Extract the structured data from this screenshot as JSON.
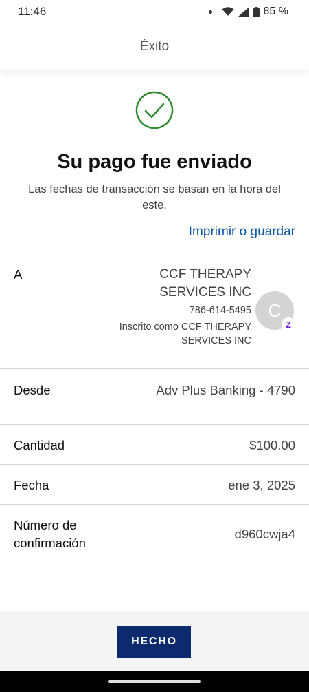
{
  "status_bar": {
    "time": "11:46",
    "battery": "85 %"
  },
  "header": {
    "title": "Éxito"
  },
  "success": {
    "headline": "Su pago fue enviado",
    "subtext": "Las fechas de transacción se basan en la hora del este."
  },
  "print_link": "Imprimir o guardar",
  "recipient": {
    "label": "A",
    "name": "CCF THERAPY SERVICES INC",
    "phone": "786-614-5495",
    "enrolled_as": "Inscrito como CCF THERAPY SERVICES INC",
    "avatar_initial": "C",
    "badge_letter": "Z"
  },
  "from": {
    "label": "Desde",
    "value": "Adv Plus Banking - 4790"
  },
  "amount": {
    "label": "Cantidad",
    "value": "$100.00"
  },
  "date": {
    "label": "Fecha",
    "value": "ene 3, 2025"
  },
  "confirmation": {
    "label": "Número de confirmación",
    "value": "d960cwja4"
  },
  "done_button": "HECHO",
  "colors": {
    "accent": "#0d2a6e",
    "link": "#0e58a8",
    "success": "#2e8b2e",
    "zelle": "#6d1ed4"
  }
}
